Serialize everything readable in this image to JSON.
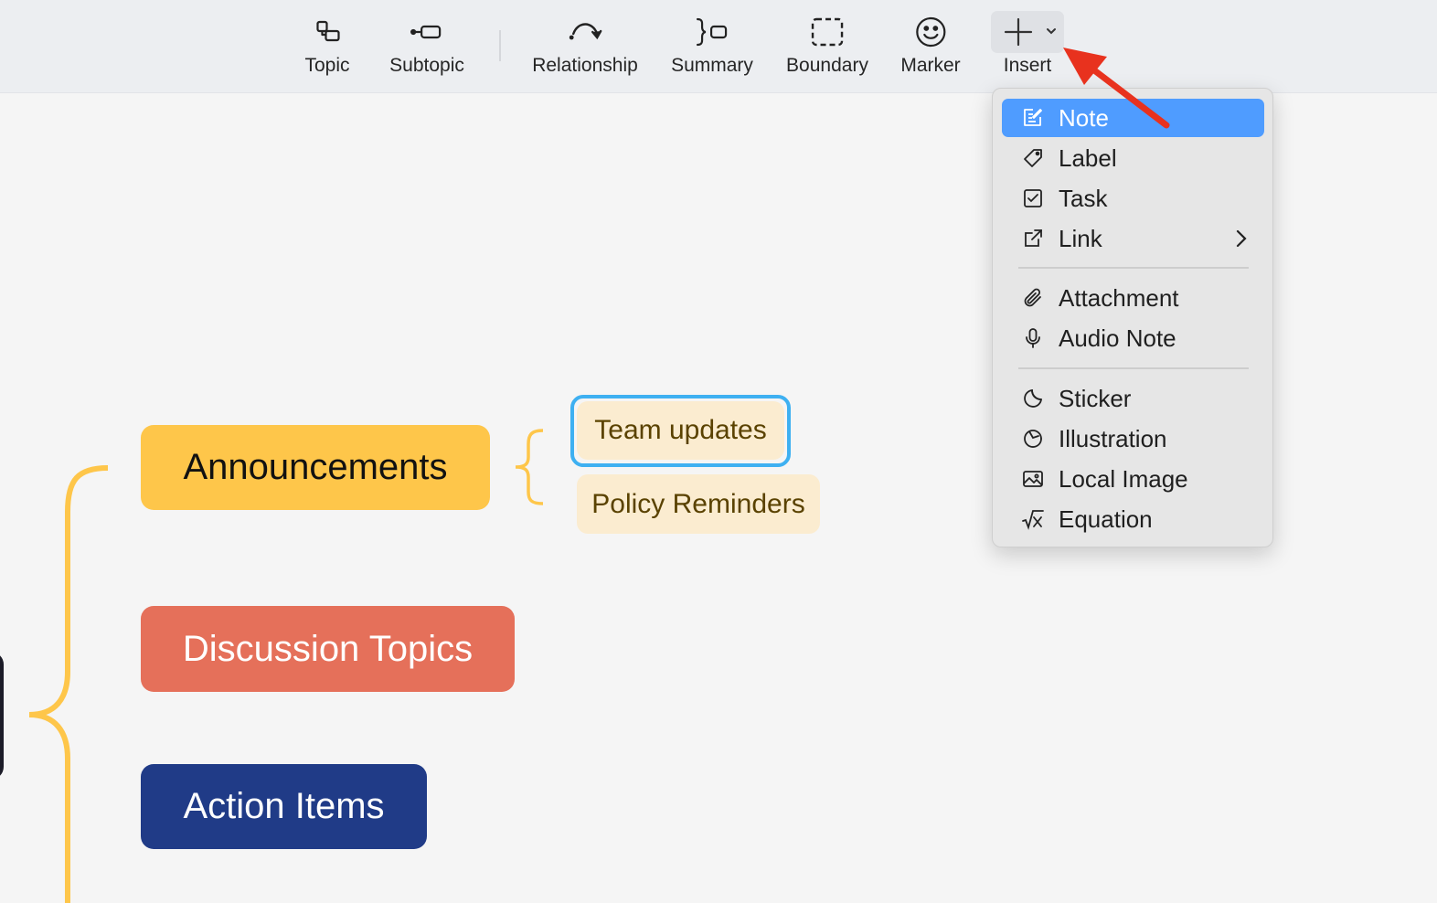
{
  "toolbar": {
    "topic": "Topic",
    "subtopic": "Subtopic",
    "relationship": "Relationship",
    "summary": "Summary",
    "boundary": "Boundary",
    "marker": "Marker",
    "insert": "Insert"
  },
  "mindmap": {
    "topics": [
      "Announcements",
      "Discussion Topics",
      "Action Items"
    ],
    "subtopics": [
      "Team updates",
      "Policy Reminders"
    ],
    "colors": {
      "announcements": "#fec64a",
      "discussion": "#e5705a",
      "action": "#203b87",
      "subtopic_bg": "#fbecd0",
      "selection": "#3eb0f1",
      "brace": "#fec64a"
    }
  },
  "insert_menu": {
    "items": [
      {
        "label": "Note",
        "icon": "note-edit-icon",
        "active": true
      },
      {
        "label": "Label",
        "icon": "tag-icon"
      },
      {
        "label": "Task",
        "icon": "checkbox-icon"
      },
      {
        "label": "Link",
        "icon": "external-link-icon",
        "submenu": true
      },
      {
        "label": "Attachment",
        "icon": "paperclip-icon"
      },
      {
        "label": "Audio Note",
        "icon": "microphone-icon"
      },
      {
        "label": "Sticker",
        "icon": "sticker-icon"
      },
      {
        "label": "Illustration",
        "icon": "illustration-icon"
      },
      {
        "label": "Local Image",
        "icon": "image-icon"
      },
      {
        "label": "Equation",
        "icon": "equation-icon"
      }
    ],
    "active_color": "#4f9cff"
  },
  "annotation": {
    "arrow_color": "#e8321e"
  }
}
